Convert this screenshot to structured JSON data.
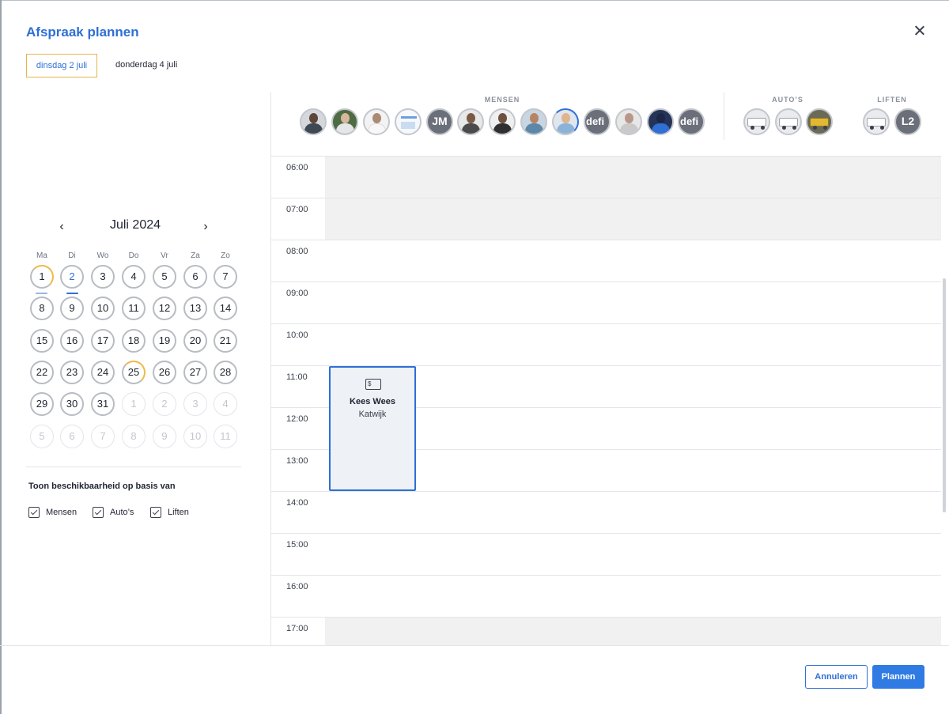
{
  "dialog": {
    "title": "Afspraak plannen"
  },
  "tabs": [
    {
      "label": "dinsdag 2 juli",
      "active": true
    },
    {
      "label": "donderdag 4 juli",
      "active": false
    }
  ],
  "calendar": {
    "month_label": "Juli 2024",
    "prev_icon": "chevron-left-icon",
    "next_icon": "chevron-right-icon",
    "weekdays": [
      "Ma",
      "Di",
      "Wo",
      "Do",
      "Vr",
      "Za",
      "Zo"
    ],
    "weeks": [
      [
        "1",
        "2",
        "3",
        "4",
        "5",
        "6",
        "7"
      ],
      [
        "8",
        "9",
        "10",
        "11",
        "12",
        "13",
        "14"
      ],
      [
        "15",
        "16",
        "17",
        "18",
        "19",
        "20",
        "21"
      ],
      [
        "22",
        "23",
        "24",
        "25",
        "26",
        "27",
        "28"
      ],
      [
        "29",
        "30",
        "31",
        "1",
        "2",
        "3",
        "4"
      ],
      [
        "5",
        "6",
        "7",
        "8",
        "9",
        "10",
        "11"
      ]
    ],
    "selected_day": "2",
    "accent_color": "#2f6fd6",
    "partial_color": "#f0b94a"
  },
  "availability": {
    "title": "Toon beschikbaarheid op basis van",
    "options": [
      {
        "label": "Mensen",
        "checked": true
      },
      {
        "label": "Auto’s",
        "checked": true
      },
      {
        "label": "Liften",
        "checked": true
      }
    ]
  },
  "resources": {
    "groups": [
      {
        "label": "MENSEN"
      },
      {
        "label": "AUTO’S"
      },
      {
        "label": "LIFTEN"
      }
    ],
    "people_initials": "JM",
    "people_text_1": "defi",
    "people_text_2": "defi",
    "lift_initials": "L2"
  },
  "schedule": {
    "times": [
      "06:00",
      "07:00",
      "08:00",
      "09:00",
      "10:00",
      "11:00",
      "12:00",
      "13:00",
      "14:00",
      "15:00",
      "16:00",
      "17:00"
    ],
    "event": {
      "name": "Kees Wees",
      "location": "Katwijk",
      "icon": "invoice-edit-icon",
      "icon_text": "$"
    }
  },
  "footer": {
    "cancel_label": "Annuleren",
    "submit_label": "Plannen"
  }
}
